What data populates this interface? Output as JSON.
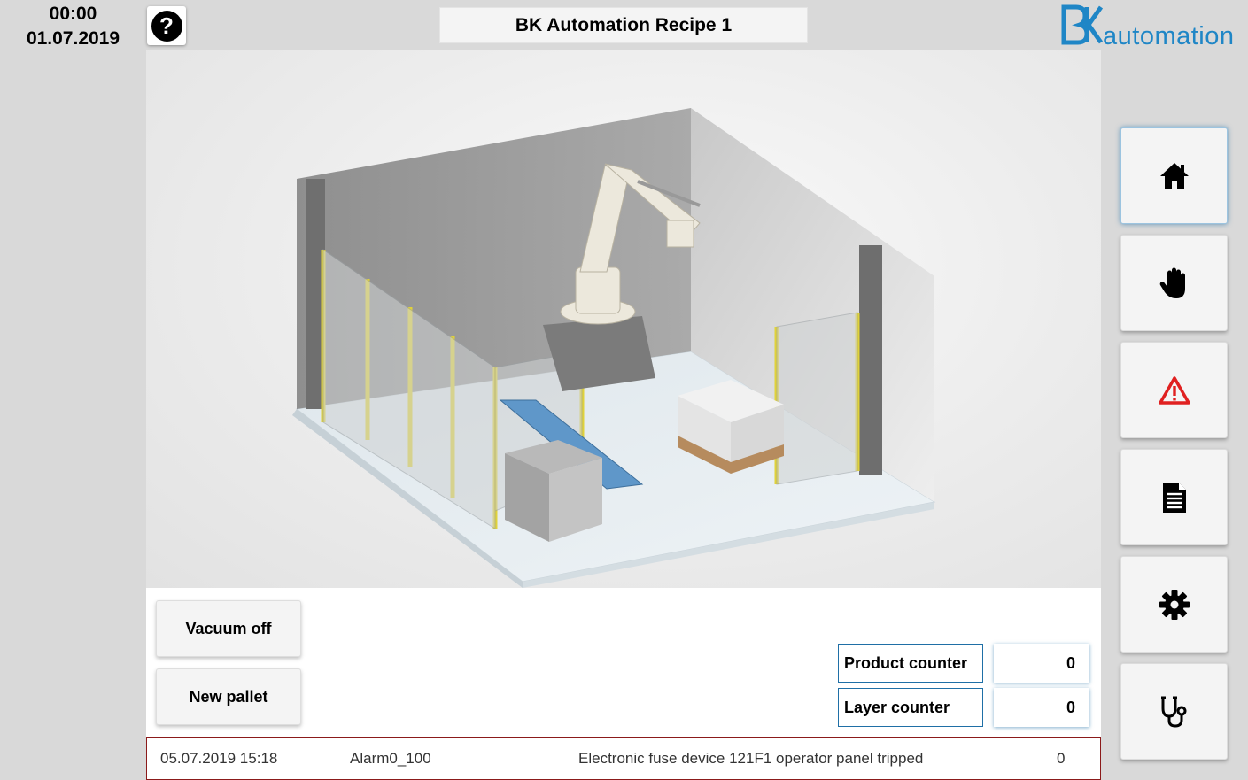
{
  "header": {
    "time": "00:00",
    "date": "01.07.2019",
    "title": "BK Automation Recipe 1",
    "help_icon": "question-circle-icon",
    "logo_text": "automation",
    "logo_mark": "BK"
  },
  "actions": {
    "vacuum_label": "Vacuum off",
    "new_pallet_label": "New pallet"
  },
  "counters": {
    "product_label": "Product counter",
    "product_value": "0",
    "layer_label": "Layer counter",
    "layer_value": "0"
  },
  "alarm": {
    "timestamp": "05.07.2019 15:18",
    "id": "Alarm0_100",
    "message": "Electronic fuse device 121F1 operator panel tripped",
    "count": "0"
  },
  "nav": [
    {
      "icon": "home-icon"
    },
    {
      "icon": "hand-icon"
    },
    {
      "icon": "warning-icon"
    },
    {
      "icon": "document-icon"
    },
    {
      "icon": "gear-icon"
    },
    {
      "icon": "stethoscope-icon"
    }
  ],
  "colors": {
    "accent": "#1f86c6",
    "alarm_border": "#8b1a1a",
    "warning": "#e02020"
  }
}
